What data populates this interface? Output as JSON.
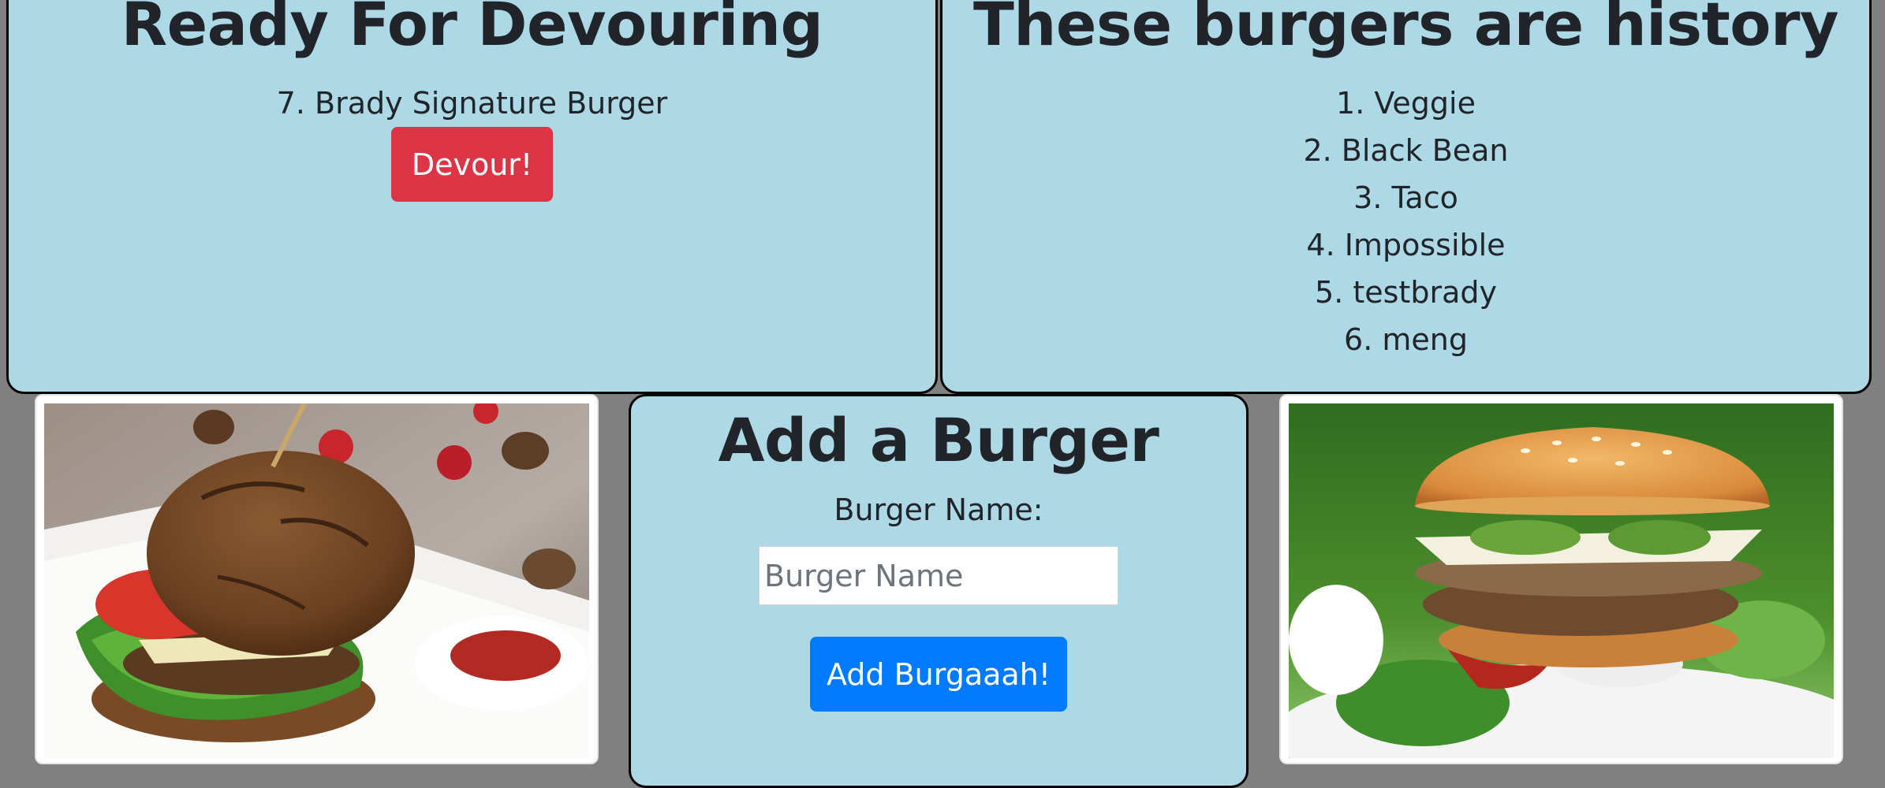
{
  "ready": {
    "title": "Ready For Devouring",
    "items": [
      {
        "label": "7. Brady Signature Burger",
        "button": "Devour!"
      }
    ]
  },
  "history": {
    "title": "These burgers are history",
    "items": [
      "1. Veggie",
      "2. Black Bean",
      "3. Taco",
      "4. Impossible",
      "5. testbrady",
      "6. meng"
    ]
  },
  "add": {
    "title": "Add a Burger",
    "field_label": "Burger Name:",
    "input_value": "",
    "input_placeholder": "Burger Name",
    "button": "Add Burgaaah!"
  },
  "colors": {
    "page_bg": "#808080",
    "panel_bg": "#add8e6",
    "danger": "#dc3545",
    "primary": "#007bff"
  }
}
